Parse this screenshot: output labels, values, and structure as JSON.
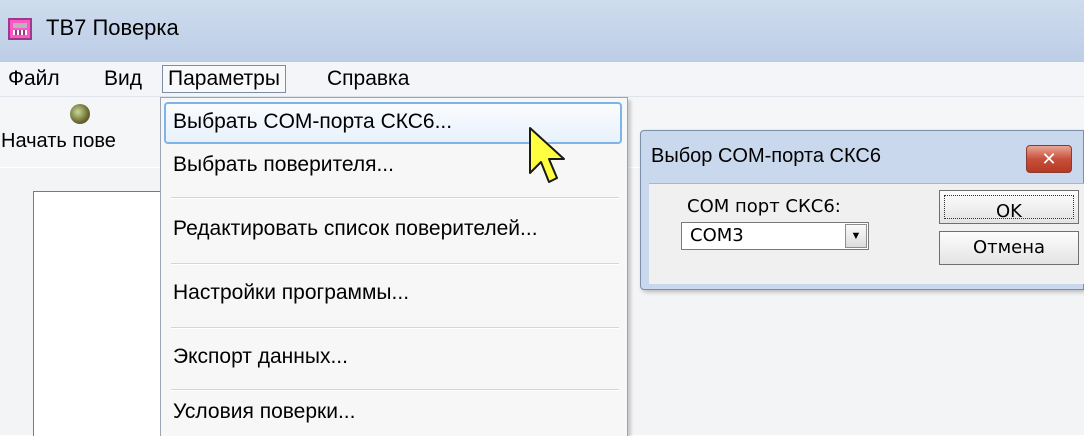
{
  "window": {
    "title": "ТВ7 Поверка"
  },
  "menu": {
    "items": [
      "Файл",
      "Вид",
      "Параметры",
      "Справка"
    ],
    "active": "Параметры"
  },
  "toolbar": {
    "start_label": "Начать пове",
    "start_icon": "start-verification-icon"
  },
  "dropdown": {
    "items": [
      "Выбрать COM-порта СКС6...",
      "Выбрать поверителя...",
      "Редактировать список поверителей...",
      "Настройки программы...",
      "Экспорт данных...",
      "Условия поверки..."
    ],
    "highlighted": "Выбрать COM-порта СКС6..."
  },
  "dialog": {
    "title": "Выбор COM-порта СКС6",
    "close_label": "✕",
    "com_label": "COM порт СКС6:",
    "com_value": "COM3",
    "ok_label": "OK",
    "cancel_label": "Отмена"
  },
  "colors": {
    "titlebar": "#c6d5eb",
    "highlight_border": "#7fb5e6",
    "close_button": "#c8503b",
    "cursor_fill": "#ffff40"
  }
}
